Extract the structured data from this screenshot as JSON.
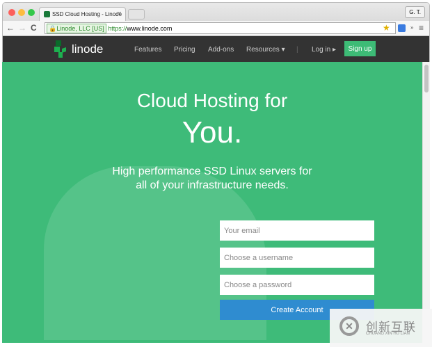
{
  "browser": {
    "tab_title": "SSD Cloud Hosting - Linode",
    "user": "G. T.",
    "ev_label": "Linode, LLC [US]",
    "url_scheme": "https://",
    "url_host": "www.linode.com"
  },
  "nav": {
    "brand": "linode",
    "items": [
      "Features",
      "Pricing",
      "Add-ons",
      "Resources ▾"
    ],
    "login": "Log in ▸",
    "signup": "Sign up"
  },
  "hero": {
    "line1": "Cloud Hosting for",
    "line2": "You.",
    "subtitle1": "High performance SSD Linux servers for",
    "subtitle2": "all of your infrastructure needs."
  },
  "form": {
    "email_placeholder": "Your email",
    "username_placeholder": "Choose a username",
    "password_placeholder": "Choose a password",
    "submit": "Create Account"
  },
  "watermark": {
    "cn": "创新互联",
    "en": "CHUANG XIN HU LIAN"
  }
}
